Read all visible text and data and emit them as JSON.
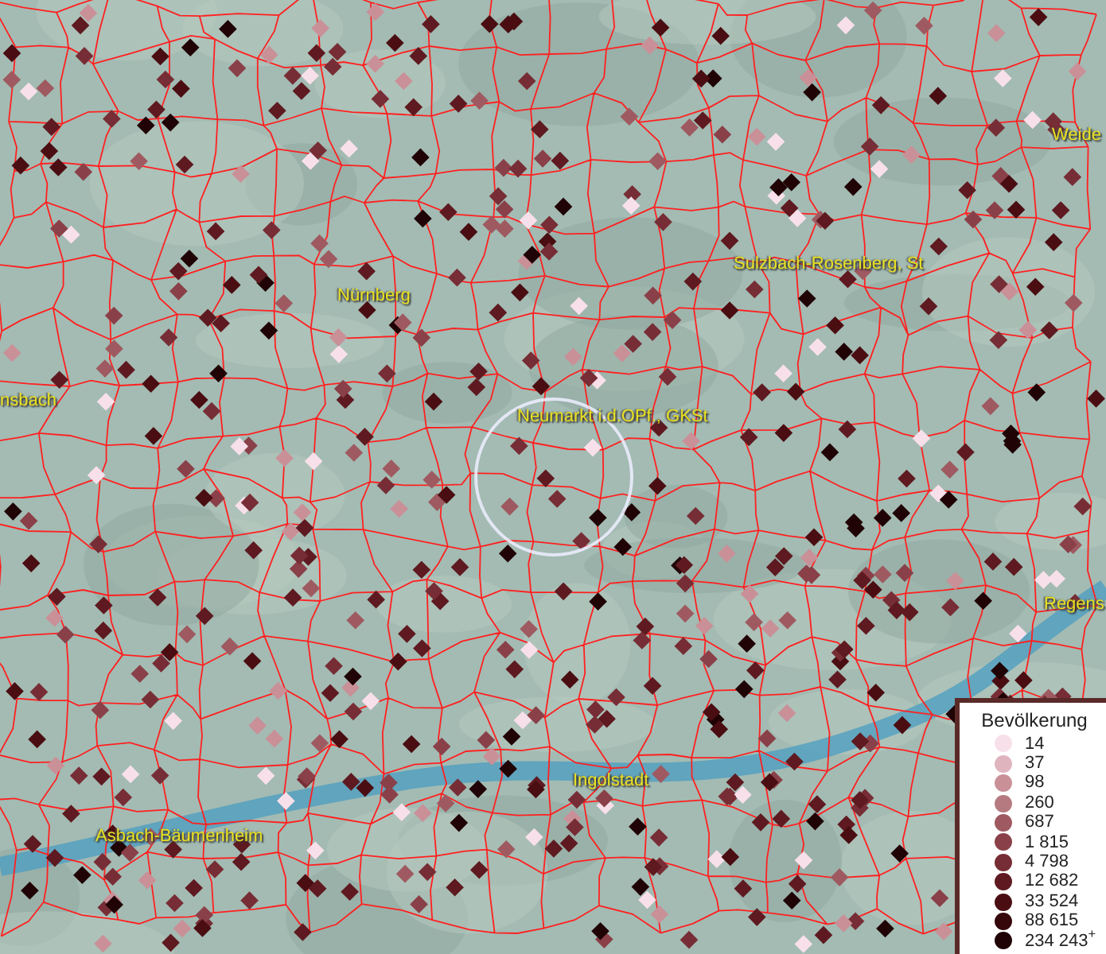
{
  "map": {
    "labels": [
      {
        "text": "Weide"
      },
      {
        "text": "Sulzbach-Rosenberg, St"
      },
      {
        "text": "Nürnberg"
      },
      {
        "text": "nsbach"
      },
      {
        "text": "Neumarkt i.d.OPf., GKSt"
      },
      {
        "text": "Regens"
      },
      {
        "text": "Ingolstadt"
      },
      {
        "text": "Asbach-Bäumenheim"
      }
    ]
  },
  "legend": {
    "title": "Bevölkerung",
    "items": [
      {
        "label": "14",
        "color": "#f8e0ea"
      },
      {
        "label": "37",
        "color": "#e0b4be"
      },
      {
        "label": "98",
        "color": "#c99098"
      },
      {
        "label": "260",
        "color": "#b57a80"
      },
      {
        "label": "687",
        "color": "#9e5a60"
      },
      {
        "label": "1 815",
        "color": "#8a4048"
      },
      {
        "label": "4 798",
        "color": "#772d35"
      },
      {
        "label": "12 682",
        "color": "#5e1a20"
      },
      {
        "label": "33 524",
        "color": "#4a0e12"
      },
      {
        "label": "88 615",
        "color": "#35070a"
      },
      {
        "label": "234 243$^{+}$",
        "color": "#200305"
      }
    ]
  }
}
